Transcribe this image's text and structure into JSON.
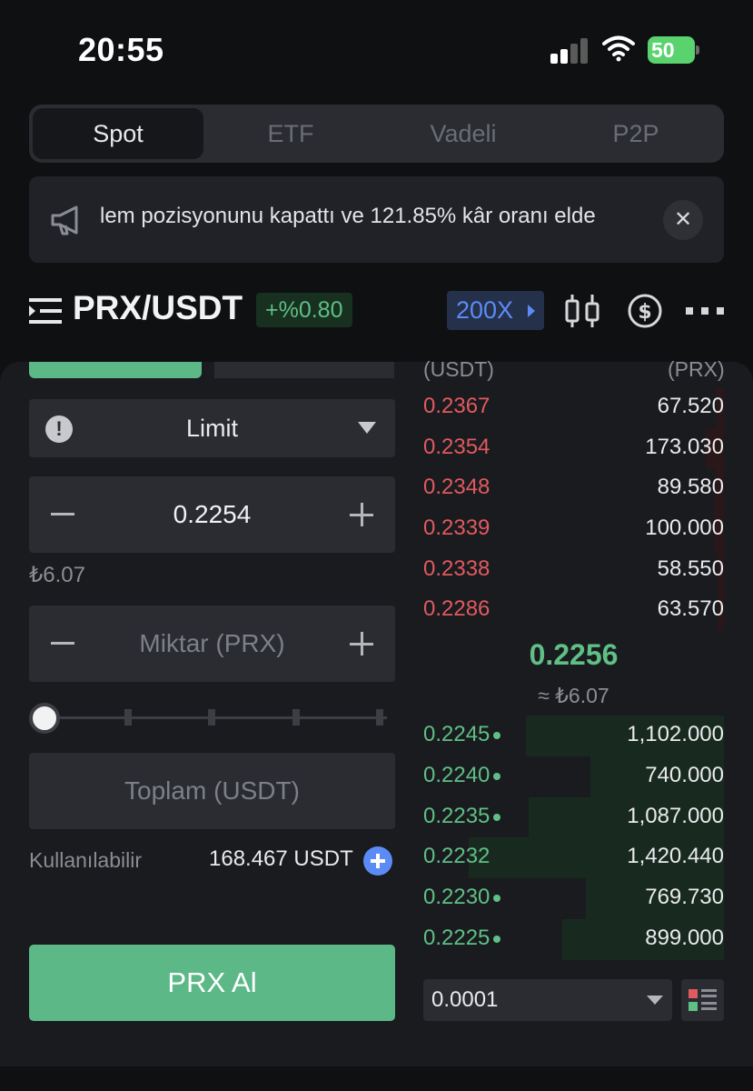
{
  "status_bar": {
    "time": "20:55",
    "battery": "50"
  },
  "tabs": [
    {
      "label": "Spot",
      "active": true
    },
    {
      "label": "ETF",
      "active": false
    },
    {
      "label": "Vadeli",
      "active": false
    },
    {
      "label": "P2P",
      "active": false
    }
  ],
  "announcement": {
    "text": "lem pozisyonunu kapattı ve 121.85% kâr oranı elde"
  },
  "pair": {
    "symbol": "PRX/USDT",
    "change": "+%0.80",
    "leverage": "200X"
  },
  "form": {
    "order_type": "Limit",
    "price": "0.2254",
    "price_fiat": "₺6.07",
    "quantity_placeholder": "Miktar (PRX)",
    "total_placeholder": "Toplam (USDT)",
    "slider_percent": 0,
    "available_label": "Kullanılabilir",
    "available_value": "168.467 USDT",
    "buy_button": "PRX Al"
  },
  "order_book": {
    "price_header": "(USDT)",
    "qty_header": "(PRX)",
    "asks": [
      {
        "price": "0.2367",
        "qty": "67.520"
      },
      {
        "price": "0.2354",
        "qty": "173.030"
      },
      {
        "price": "0.2348",
        "qty": "89.580"
      },
      {
        "price": "0.2339",
        "qty": "100.000"
      },
      {
        "price": "0.2338",
        "qty": "58.550"
      },
      {
        "price": "0.2286",
        "qty": "63.570"
      }
    ],
    "mid_price": "0.2256",
    "mid_fiat": "≈ ₺6.07",
    "bids": [
      {
        "price": "0.2245",
        "qty": "1,102.000",
        "dot": true
      },
      {
        "price": "0.2240",
        "qty": "740.000",
        "dot": true
      },
      {
        "price": "0.2235",
        "qty": "1,087.000",
        "dot": true
      },
      {
        "price": "0.2232",
        "qty": "1,420.440",
        "dot": false
      },
      {
        "price": "0.2230",
        "qty": "769.730",
        "dot": true
      },
      {
        "price": "0.2225",
        "qty": "899.000",
        "dot": true
      }
    ],
    "tick_size": "0.0001"
  },
  "colors": {
    "buy": "#5db888",
    "sell": "#e05a5f",
    "accent": "#5b8cf5"
  },
  "icons": [
    "signal-icon",
    "wifi-icon",
    "battery-icon",
    "megaphone-icon",
    "close-icon",
    "menu-icon",
    "candlestick-icon",
    "dollar-icon",
    "more-icon",
    "info-icon",
    "caret-down-icon",
    "minus-icon",
    "plus-icon",
    "add-funds-icon",
    "orderbook-layout-icon"
  ]
}
